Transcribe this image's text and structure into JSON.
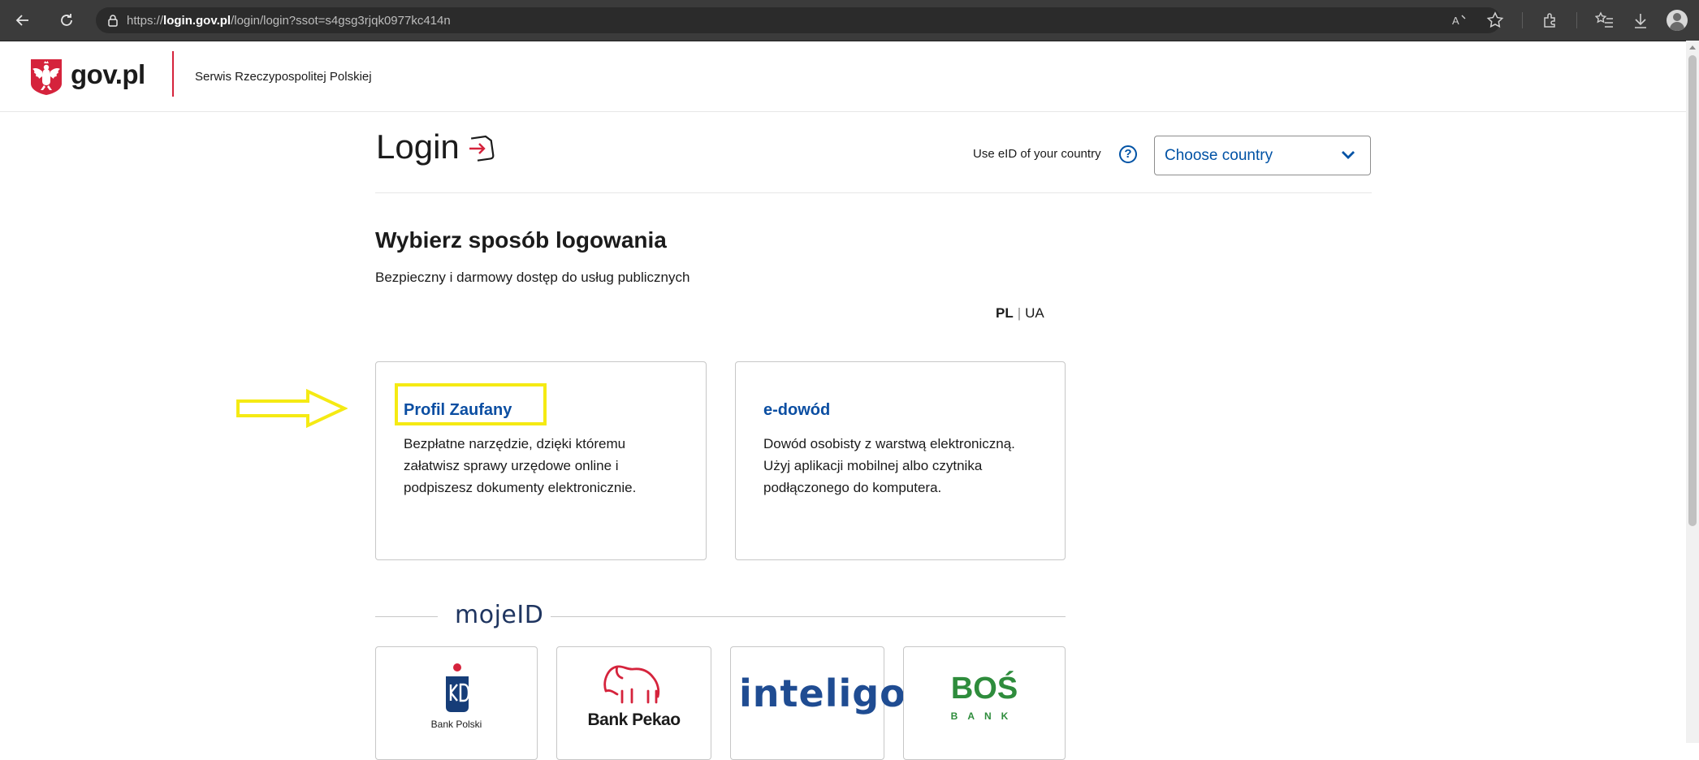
{
  "browser": {
    "url_prefix": "https://",
    "url_host": "login.gov.pl",
    "url_path": "/login/login?ssot=s4gsg3rjqk0977kc414n"
  },
  "header": {
    "logo_text": "gov.pl",
    "service_name": "Serwis Rzeczypospolitej Polskiej"
  },
  "login": {
    "title": "Login",
    "eid_label": "Use eID of your country",
    "help_glyph": "?",
    "country_select_value": "Choose country"
  },
  "main": {
    "heading": "Wybierz sposób logowania",
    "subheading": "Bezpieczny i darmowy dostęp do usług publicznych",
    "lang_pl": "PL",
    "lang_sep": "|",
    "lang_ua": "UA"
  },
  "cards": [
    {
      "title": "Profil Zaufany",
      "description": "Bezpłatne narzędzie, dzięki któremu załatwisz sprawy urzędowe online i podpiszesz dokumenty elektronicznie."
    },
    {
      "title": "e-dowód",
      "description": "Dowód osobisty z warstwą elektroniczną. Użyj aplikacji mobilnej albo czytnika podłączonego do komputera."
    }
  ],
  "mojeid": {
    "logo_text": "mojeID"
  },
  "banks": [
    {
      "name": "Bank Polski"
    },
    {
      "name": "Bank Pekao"
    },
    {
      "name": "inteligo"
    },
    {
      "name": "BOŚ",
      "sub": "BANK"
    }
  ],
  "colors": {
    "brand_blue": "#0052a5",
    "gov_red": "#d5233c",
    "highlight_yellow": "#f5ea13"
  },
  "icons": [
    "back-arrow-icon",
    "refresh-icon",
    "lock-icon",
    "read-aloud-icon",
    "favorite-icon",
    "extensions-icon",
    "favorites-list-icon",
    "download-icon",
    "profile-icon",
    "login-icon",
    "help-icon",
    "chevron-down-icon",
    "arrow-annotation-icon"
  ]
}
